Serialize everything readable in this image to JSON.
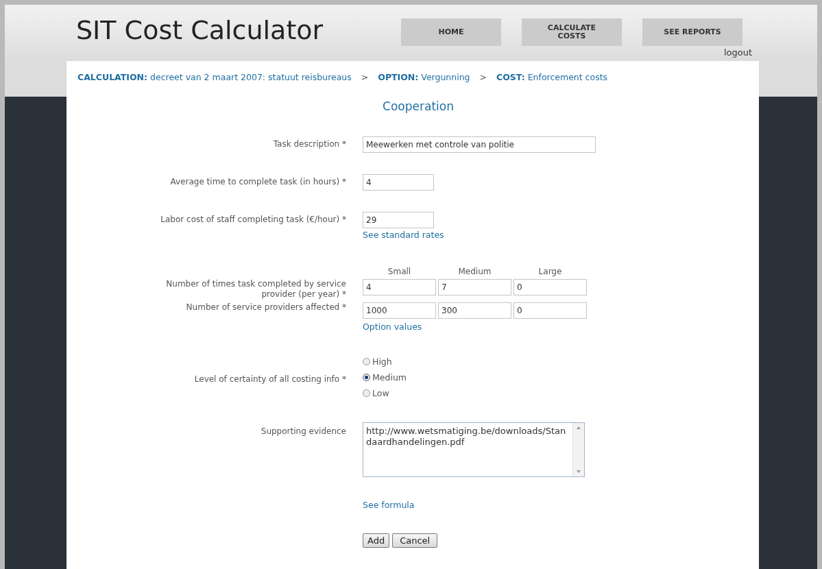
{
  "app_title": "SIT Cost Calculator",
  "nav": [
    {
      "label": "HOME"
    },
    {
      "label": "CALCULATE COSTS"
    },
    {
      "label": "SEE REPORTS"
    }
  ],
  "logout": "logout",
  "breadcrumb": [
    {
      "key": "CALCULATION:",
      "value": "decreet van 2 maart 2007: statuut reisbureaus"
    },
    {
      "key": "OPTION:",
      "value": "Vergunning"
    },
    {
      "key": "COST:",
      "value": "Enforcement costs"
    }
  ],
  "breadcrumb_separator": ">",
  "heading": "Cooperation",
  "fields": [
    {
      "kind": "long_text",
      "label": "Task description *",
      "value": "Meewerken met controle van politie"
    },
    {
      "kind": "number",
      "label": "Average time to complete task (in hours) *",
      "value": "4"
    },
    {
      "kind": "number",
      "label": "Labor cost of staff completing task (€/hour) *",
      "value": "29",
      "link": "See standard rates"
    },
    {
      "kind": "grid",
      "columns": [
        "Small",
        "Medium",
        "Large"
      ],
      "rows": [
        {
          "label": "Number of times task completed by service provider (per year) *",
          "values": [
            "4",
            "7",
            "0"
          ]
        },
        {
          "label": "Number of service providers affected *",
          "values": [
            "1000",
            "300",
            "0"
          ]
        }
      ],
      "link": "Option values"
    },
    {
      "kind": "radio",
      "label": "Level of certainty of all costing info *",
      "options": [
        {
          "label": "High",
          "selected": false
        },
        {
          "label": "Medium",
          "selected": true
        },
        {
          "label": "Low",
          "selected": false
        }
      ]
    },
    {
      "kind": "textarea",
      "label": "Supporting evidence",
      "value": "http://www.wetsmatiging.be/downloads/Standaardhandelingen.pdf"
    }
  ],
  "formula_link": "See formula",
  "buttons": [
    {
      "label": "Add"
    },
    {
      "label": "Cancel"
    }
  ]
}
